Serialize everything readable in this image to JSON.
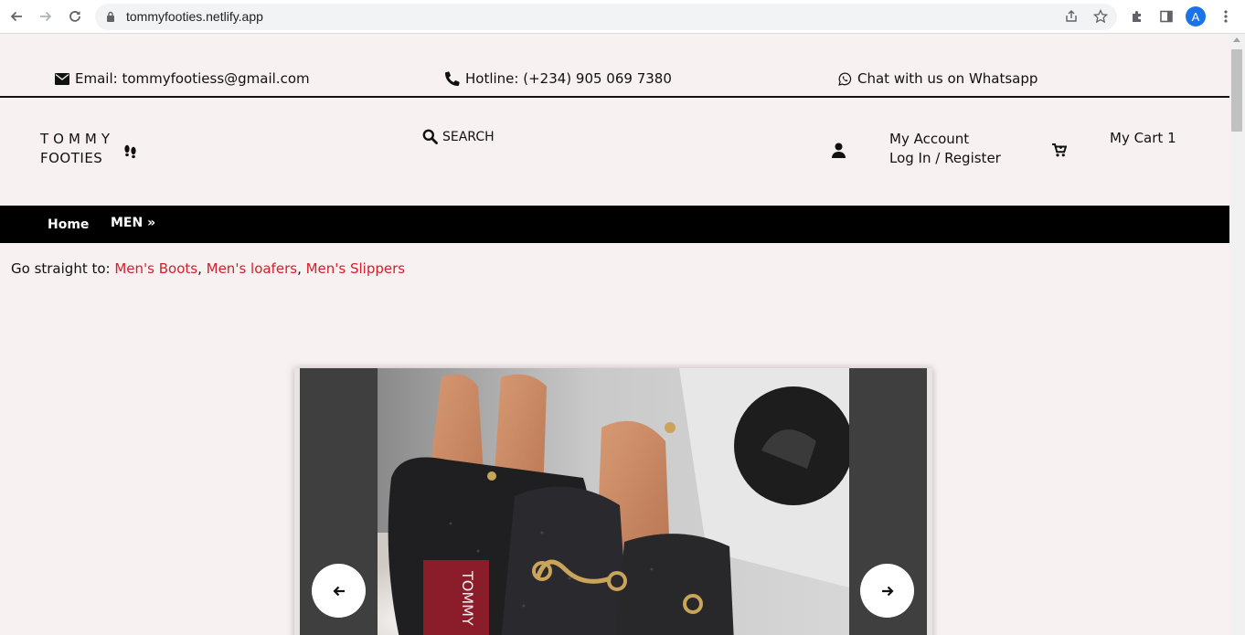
{
  "browser": {
    "url": "tommyfooties.netlify.app",
    "profile_initial": "A"
  },
  "contact_bar": {
    "email": "Email: tommyfootiess@gmail.com",
    "hotline": "Hotline: (+234) 905 069 7380",
    "whatsapp": "Chat with us on Whatsapp"
  },
  "header": {
    "logo_line1": "TOMMY",
    "logo_line2": "FOOTIES",
    "search_label": "SEARCH",
    "account_line1": "My Account",
    "account_line2": "Log In / Register",
    "cart_label": "My Cart 1"
  },
  "nav": {
    "home": "Home",
    "men": "MEN »"
  },
  "go_straight": {
    "prefix": "Go straight to: ",
    "links": [
      "Men's Boots",
      "Men's loafers",
      "Men's Slippers"
    ],
    "separator": ", "
  },
  "carousel": {
    "prev_icon": "arrow-left-icon",
    "next_icon": "arrow-right-icon",
    "tag_text": "TOMMY"
  },
  "colors": {
    "page_bg": "#f8f1f1",
    "link_red": "#d21f2b",
    "nav_bg": "#000000",
    "carousel_bg": "#3f3f3f"
  }
}
